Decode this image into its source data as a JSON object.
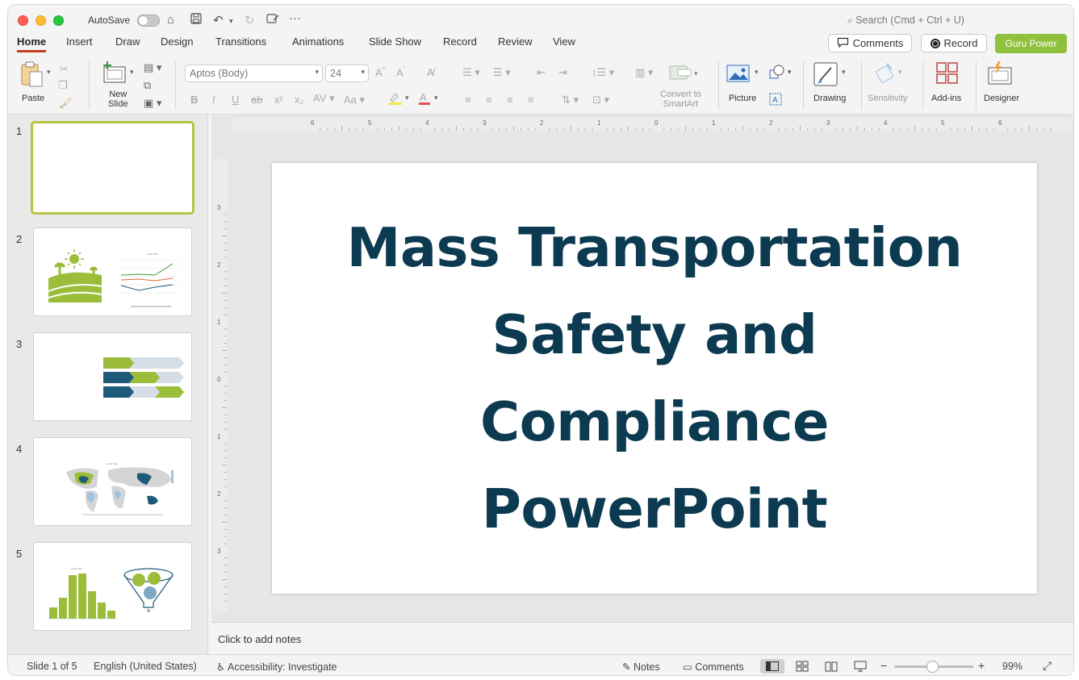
{
  "titlebar": {
    "autosave_label": "AutoSave",
    "search_placeholder": "Search (Cmd + Ctrl + U)"
  },
  "tabs": [
    "Home",
    "Insert",
    "Draw",
    "Design",
    "Transitions",
    "Animations",
    "Slide Show",
    "Record",
    "Review",
    "View"
  ],
  "header_buttons": {
    "comments": "Comments",
    "record": "Record",
    "guru": "Guru Power"
  },
  "ribbon": {
    "paste": "Paste",
    "new_slide_1": "New",
    "new_slide_2": "Slide",
    "font_name": "Aptos (Body)",
    "font_size": "24",
    "convert_1": "Convert to",
    "convert_2": "SmartArt",
    "picture": "Picture",
    "drawing": "Drawing",
    "sensitivity": "Sensitivity",
    "addins": "Add-ins",
    "designer": "Designer"
  },
  "thumbnails": [
    {
      "number": "1"
    },
    {
      "number": "2"
    },
    {
      "number": "3"
    },
    {
      "number": "4"
    },
    {
      "number": "5"
    }
  ],
  "slide": {
    "title_lines": [
      "Mass Transportation",
      "Safety and",
      "Compliance",
      "PowerPoint"
    ]
  },
  "notes_placeholder": "Click to add notes",
  "status": {
    "slide_count": "Slide 1 of 5",
    "language": "English (United States)",
    "accessibility": "Accessibility: Investigate",
    "notes": "Notes",
    "comments": "Comments",
    "zoom": "99%"
  },
  "ruler": {
    "h_labels": [
      "6",
      "5",
      "4",
      "3",
      "2",
      "1",
      "0",
      "1",
      "2",
      "3",
      "4",
      "5",
      "6"
    ],
    "v_labels": [
      "3",
      "2",
      "1",
      "0",
      "1",
      "2",
      "3"
    ]
  },
  "colors": {
    "accent_tab": "#c43e1c",
    "guru_button": "#8fc13f",
    "title_text": "#0c3a51",
    "green": "#9bbd3a",
    "navy": "#1f5a7a"
  }
}
